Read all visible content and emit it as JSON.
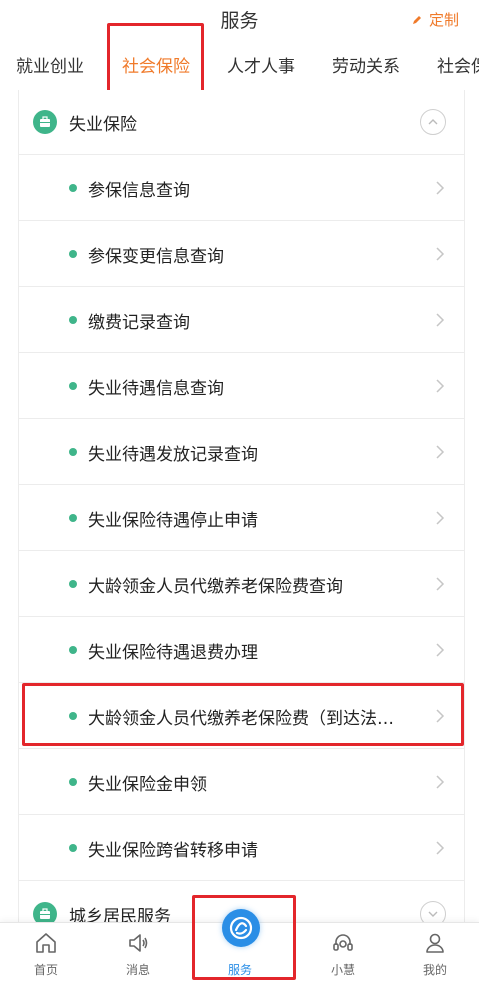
{
  "header": {
    "title": "服务",
    "customize_label": "定制"
  },
  "tabs": [
    {
      "label": "就业创业",
      "active": false
    },
    {
      "label": "社会保险",
      "active": true
    },
    {
      "label": "人才人事",
      "active": false
    },
    {
      "label": "劳动关系",
      "active": false
    },
    {
      "label": "社会保",
      "active": false
    }
  ],
  "section": {
    "title": "失业保险",
    "items": [
      {
        "label": "参保信息查询"
      },
      {
        "label": "参保变更信息查询"
      },
      {
        "label": "缴费记录查询"
      },
      {
        "label": "失业待遇信息查询"
      },
      {
        "label": "失业待遇发放记录查询"
      },
      {
        "label": "失业保险待遇停止申请"
      },
      {
        "label": "大龄领金人员代缴养老保险费查询"
      },
      {
        "label": "失业保险待遇退费办理"
      },
      {
        "label": "大龄领金人员代缴养老保险费（到达法…"
      },
      {
        "label": "失业保险金申领"
      },
      {
        "label": "失业保险跨省转移申请"
      }
    ]
  },
  "next_section": {
    "title": "城乡居民服务"
  },
  "bottom_nav": [
    {
      "label": "首页",
      "icon": "home-icon"
    },
    {
      "label": "消息",
      "icon": "speaker-icon"
    },
    {
      "label": "服务",
      "icon": "service-logo-icon",
      "active": true
    },
    {
      "label": "小慧",
      "icon": "headset-icon"
    },
    {
      "label": "我的",
      "icon": "person-icon"
    }
  ],
  "colors": {
    "accent": "#f07a2a",
    "green": "#3fb58a",
    "blue": "#2a8ee6",
    "highlight": "#e3262b"
  }
}
